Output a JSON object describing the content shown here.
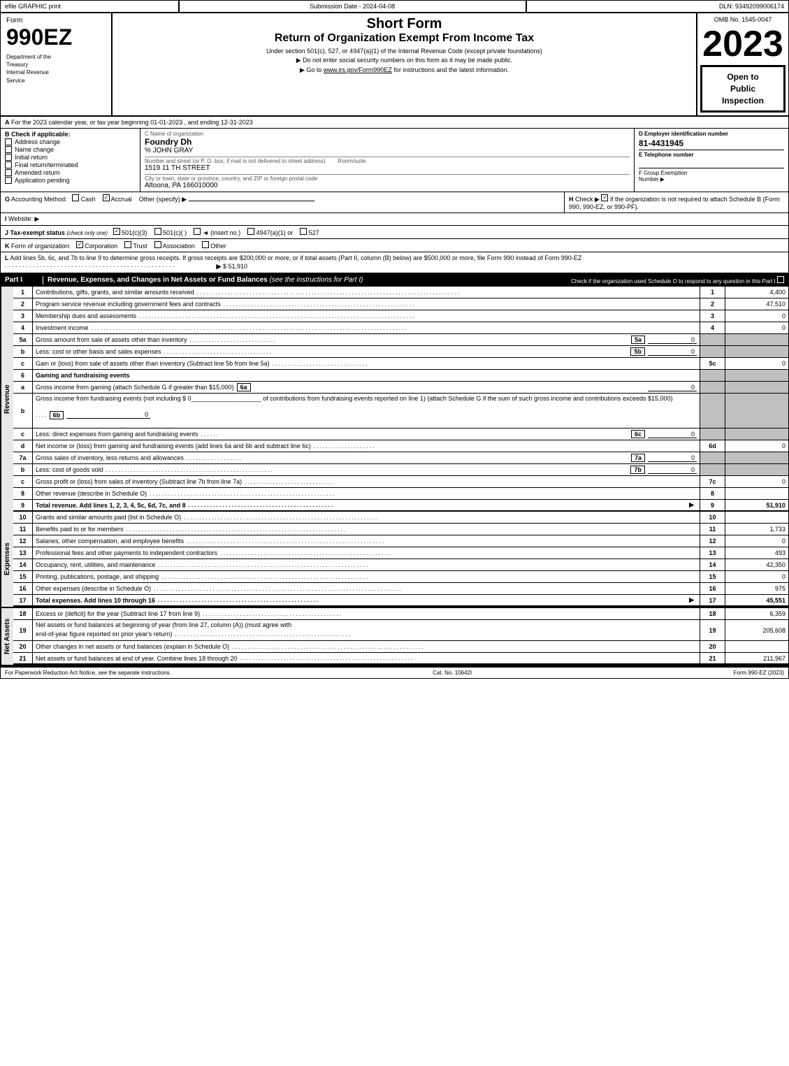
{
  "header": {
    "efile_label": "efile GRAPHIC print",
    "submission_label": "Submission Date - 2024-04-08",
    "dln_label": "DLN: 93492099006174",
    "omb": "OMB No. 1545-0047",
    "form_number": "990EZ",
    "form_label": "Form",
    "short_form": "Short Form",
    "return_title": "Return of Organization Exempt From Income Tax",
    "subtitle": "Under section 501(c), 527, or 4947(a)(1) of the Internal Revenue Code (except private foundations)",
    "instruction1": "▶ Do not enter social security numbers on this form as it may be made public.",
    "instruction2": "▶ Go to www.irs.gov/Form990EZ for instructions and the latest information.",
    "year": "2023",
    "open_public": "Open to\nPublic\nInspection",
    "dept_line1": "Department of the",
    "dept_line2": "Treasury",
    "dept_line3": "Internal Revenue",
    "dept_line4": "Service"
  },
  "section_a": {
    "label": "A",
    "text": "For the 2023 calendar year, or tax year beginning 01-01-2023 , and ending 12-31-2023"
  },
  "section_b": {
    "label": "B",
    "check_label": "Check if applicable:",
    "checks": [
      {
        "id": "address_change",
        "label": "Address change",
        "checked": false
      },
      {
        "id": "name_change",
        "label": "Name change",
        "checked": false
      },
      {
        "id": "initial_return",
        "label": "Initial return",
        "checked": false
      },
      {
        "id": "final_return",
        "label": "Final return/terminated",
        "checked": false
      },
      {
        "id": "amended_return",
        "label": "Amended return",
        "checked": false
      },
      {
        "id": "application_pending",
        "label": "Application pending",
        "checked": false
      }
    ],
    "c_label": "C Name of organization",
    "org_name": "Foundry Dh",
    "care_of": "% JOHN GRAY",
    "address_label": "Number and street (or P. O. box, if mail is not delivered to street address)",
    "address": "1519 11 TH STREET",
    "room_label": "Room/suite",
    "city_label": "City or town, state or province, country, and ZIP or foreign postal code",
    "city": "Altoona, PA  166010000",
    "d_label": "D Employer identification number",
    "ein": "81-4431945",
    "e_label": "E Telephone number",
    "e_value": "",
    "f_label": "F Group Exemption",
    "f_label2": "Number",
    "f_arrow": "▶"
  },
  "section_g": {
    "label": "G",
    "text": "Accounting Method:",
    "cash_label": "Cash",
    "accrual_label": "Accrual",
    "accrual_checked": true,
    "other_label": "Other (specify) ▶",
    "other_line": "_______________________"
  },
  "section_h": {
    "label": "H",
    "text": "Check ▶",
    "checkbox": true,
    "description": "if the organization is not required to attach Schedule B (Form 990, 990-EZ, or 990-PF)."
  },
  "section_i": {
    "label": "I",
    "text": "Website: ▶"
  },
  "section_j": {
    "label": "J",
    "text": "Tax-exempt status",
    "check_note": "(check only one)",
    "options": [
      {
        "label": "501(c)(3)",
        "checked": true
      },
      {
        "label": "501(c)(  )",
        "checked": false
      },
      {
        "label": "(insert no.)",
        "checked": false
      },
      {
        "label": "4947(a)(1) or",
        "checked": false
      },
      {
        "label": "527",
        "checked": false
      }
    ]
  },
  "section_k": {
    "label": "K",
    "text": "Form of organization:",
    "options": [
      {
        "label": "Corporation",
        "checked": true
      },
      {
        "label": "Trust",
        "checked": false
      },
      {
        "label": "Association",
        "checked": false
      },
      {
        "label": "Other",
        "checked": false
      }
    ]
  },
  "section_l": {
    "label": "L",
    "text": "Add lines 5b, 6c, and 7b to line 9 to determine gross receipts. If gross receipts are $200,000 or more, or if total assets (Part II, column (B) below) are $500,000 or more, file Form 990 instead of Form 990-EZ",
    "arrow": "▶",
    "value": "$ 51,910"
  },
  "part1": {
    "label": "Part I",
    "title": "Revenue, Expenses, and Changes in Net Assets or Fund Balances",
    "subtitle": "(see the instructions for Part I)",
    "check_note": "Check if the organization used Schedule O to respond to any question in this Part I",
    "side_label": "Revenue",
    "rows": [
      {
        "num": "1",
        "desc": "Contributions, gifts, grants, and similar amounts received",
        "line": "1",
        "value": "4,400"
      },
      {
        "num": "2",
        "desc": "Program service revenue including government fees and contracts",
        "line": "2",
        "value": "47,510"
      },
      {
        "num": "3",
        "desc": "Membership dues and assessments",
        "line": "3",
        "value": "0"
      },
      {
        "num": "4",
        "desc": "Investment income",
        "line": "4",
        "value": "0"
      }
    ],
    "row5a": {
      "num": "5a",
      "desc": "Gross amount from sale of assets other than inventory",
      "inline_label": "5a",
      "inline_val": "0"
    },
    "row5b": {
      "num": "b",
      "desc": "Less: cost or other basis and sales expenses",
      "inline_label": "5b",
      "inline_val": "0"
    },
    "row5c": {
      "num": "c",
      "desc": "Gain or (loss) from sale of assets other than inventory (Subtract line 5b from line 5a)",
      "line": "5c",
      "value": "0"
    },
    "row6": {
      "num": "6",
      "desc": "Gaming and fundraising events"
    },
    "row6a": {
      "num": "a",
      "desc": "Gross income from gaming (attach Schedule G if greater than $15,000)",
      "inline_label": "6a",
      "inline_val": "0"
    },
    "row6b_desc": "Gross income from fundraising events (not including $",
    "row6b_amount": "0",
    "row6b_cont": "of contributions from fundraising events reported on line 1) (attach Schedule G if the sum of such gross income and contributions exceeds $15,000)",
    "row6b_inline": "6b",
    "row6b_val": "0",
    "row6c": {
      "num": "c",
      "desc": "Less: direct expenses from gaming and fundraising events",
      "inline_label": "6c",
      "inline_val": "0"
    },
    "row6d": {
      "num": "d",
      "desc": "Net income or (loss) from gaming and fundraising events (add lines 6a and 6b and subtract line 6c)",
      "line": "6d",
      "value": "0"
    },
    "row7a": {
      "num": "7a",
      "desc": "Gross sales of inventory, less returns and allowances",
      "inline_label": "7a",
      "inline_val": "0"
    },
    "row7b": {
      "num": "b",
      "desc": "Less: cost of goods sold",
      "inline_label": "7b",
      "inline_val": "0"
    },
    "row7c": {
      "num": "c",
      "desc": "Gross profit or (loss) from sales of inventory (Subtract line 7b from line 7a)",
      "line": "7c",
      "value": "0"
    },
    "row8": {
      "num": "8",
      "desc": "Other revenue (describe in Schedule O)",
      "line": "8",
      "value": ""
    },
    "row9": {
      "num": "9",
      "desc": "Total revenue. Add lines 1, 2, 3, 4, 5c, 6d, 7c, and 8",
      "line": "9",
      "value": "51,910",
      "bold": true
    }
  },
  "part1_expenses": {
    "side_label": "Expenses",
    "rows": [
      {
        "num": "10",
        "desc": "Grants and similar amounts paid (list in Schedule O)",
        "line": "10",
        "value": ""
      },
      {
        "num": "11",
        "desc": "Benefits paid to or for members",
        "line": "11",
        "value": "1,733"
      },
      {
        "num": "12",
        "desc": "Salaries, other compensation, and employee benefits",
        "line": "12",
        "value": "0"
      },
      {
        "num": "13",
        "desc": "Professional fees and other payments to independent contractors",
        "line": "13",
        "value": "493"
      },
      {
        "num": "14",
        "desc": "Occupancy, rent, utilities, and maintenance",
        "line": "14",
        "value": "42,350"
      },
      {
        "num": "15",
        "desc": "Printing, publications, postage, and shipping",
        "line": "15",
        "value": "0"
      },
      {
        "num": "16",
        "desc": "Other expenses (describe in Schedule O)",
        "line": "16",
        "value": "975"
      },
      {
        "num": "17",
        "desc": "Total expenses. Add lines 10 through 16",
        "line": "17",
        "value": "45,551",
        "bold": true
      }
    ]
  },
  "part1_net": {
    "side_label": "Net Assets",
    "rows": [
      {
        "num": "18",
        "desc": "Excess or (deficit) for the year (Subtract line 17 from line 9)",
        "line": "18",
        "value": "6,359"
      },
      {
        "num": "19",
        "desc": "Net assets or fund balances at beginning of year (from line 27, column (A)) (must agree with end-of-year figure reported on prior year's return)",
        "line": "19",
        "value": "205,608"
      },
      {
        "num": "20",
        "desc": "Other changes in net assets or fund balances (explain in Schedule O)",
        "line": "20",
        "value": ""
      },
      {
        "num": "21",
        "desc": "Net assets or fund balances at end of year. Combine lines 18 through 20",
        "line": "21",
        "value": "211,967"
      }
    ]
  },
  "footer": {
    "left": "For Paperwork Reduction Act Notice, see the separate instructions.",
    "center": "Cat. No. 10642I",
    "right": "Form 990-EZ (2023)"
  }
}
